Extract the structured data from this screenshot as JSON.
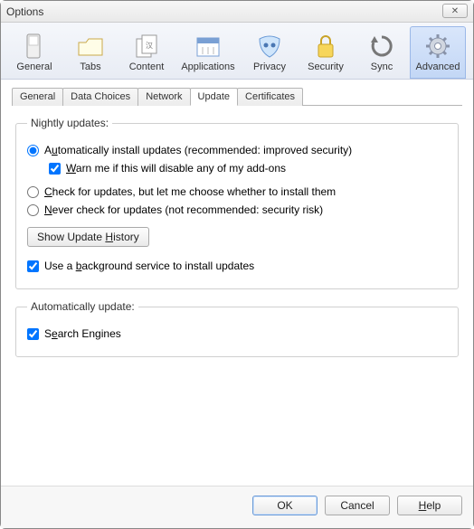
{
  "window": {
    "title": "Options",
    "close_glyph": "✕"
  },
  "categories": [
    {
      "label": "General"
    },
    {
      "label": "Tabs"
    },
    {
      "label": "Content"
    },
    {
      "label": "Applications"
    },
    {
      "label": "Privacy"
    },
    {
      "label": "Security"
    },
    {
      "label": "Sync"
    },
    {
      "label": "Advanced",
      "selected": true
    }
  ],
  "subtabs": [
    {
      "label": "General"
    },
    {
      "label": "Data Choices"
    },
    {
      "label": "Network"
    },
    {
      "label": "Update",
      "active": true
    },
    {
      "label": "Certificates"
    }
  ],
  "update_group": {
    "legend": "Nightly updates:",
    "auto_install": {
      "text_pre": "A",
      "text_u": "u",
      "text_post": "tomatically install updates (recommended: improved security)",
      "checked": true
    },
    "warn_addons": {
      "text_pre": "",
      "text_u": "W",
      "text_post": "arn me if this will disable any of my add-ons",
      "checked": true
    },
    "check_only": {
      "text_pre": "",
      "text_u": "C",
      "text_post": "heck for updates, but let me choose whether to install them",
      "checked": false
    },
    "never": {
      "text_pre": "",
      "text_u": "N",
      "text_post": "ever check for updates (not recommended: security risk)",
      "checked": false
    },
    "history_btn_pre": "Show Update ",
    "history_btn_u": "H",
    "history_btn_post": "istory",
    "bg_service": {
      "text_pre": "Use a ",
      "text_u": "b",
      "text_post": "ackground service to install updates",
      "checked": true
    }
  },
  "auto_update_group": {
    "legend": "Automatically update:",
    "search_engines": {
      "text_pre": "S",
      "text_u": "e",
      "text_post": "arch Engines",
      "checked": true
    }
  },
  "footer": {
    "ok": "OK",
    "cancel": "Cancel",
    "help_pre": "",
    "help_u": "H",
    "help_post": "elp"
  }
}
